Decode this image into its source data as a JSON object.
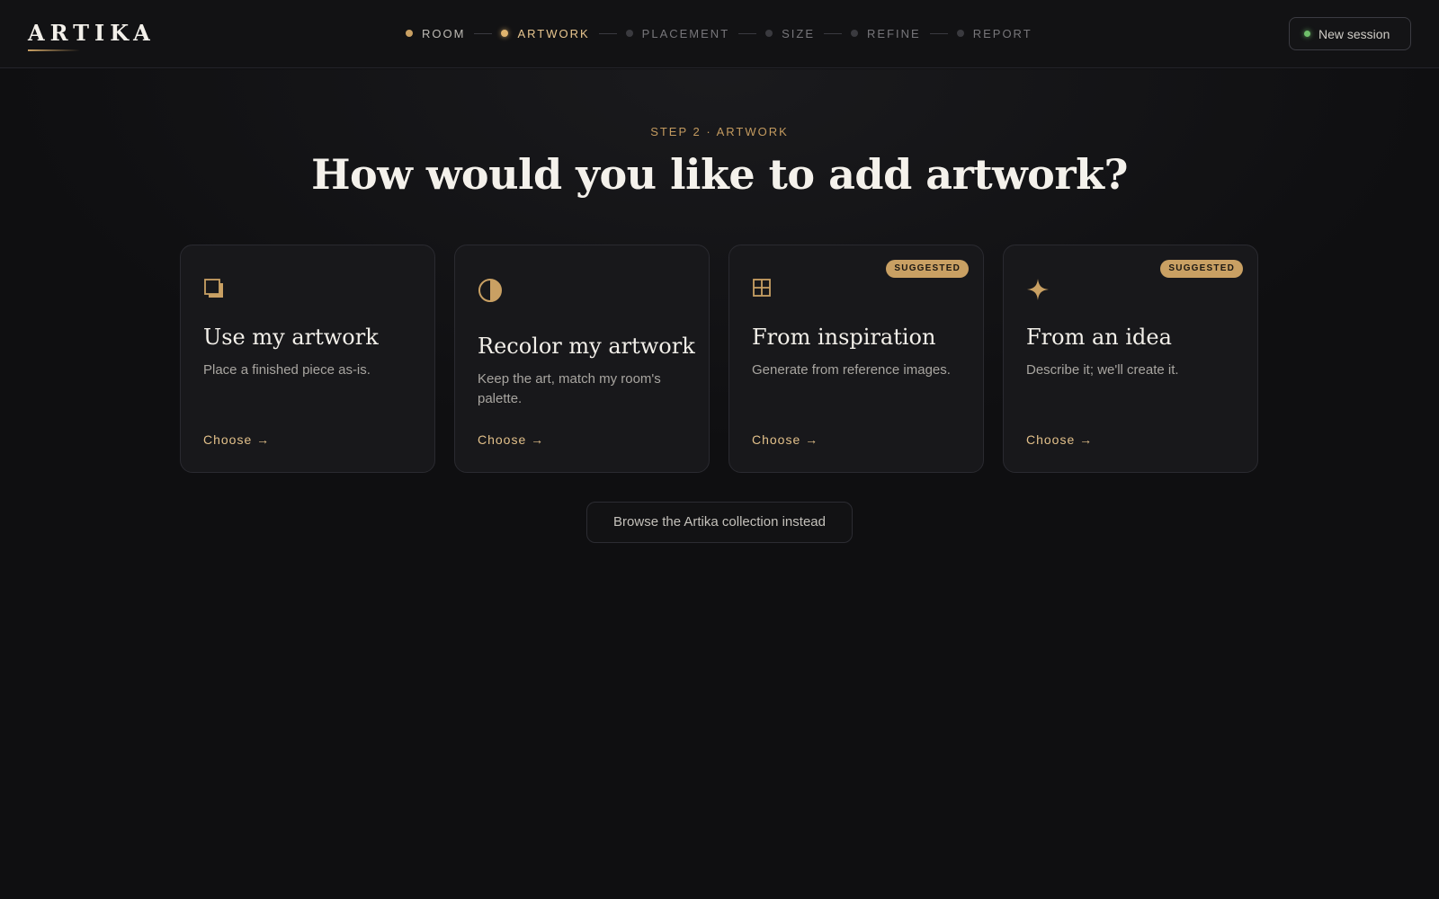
{
  "header": {
    "logo": "ARTIKA",
    "steps": [
      {
        "label": "ROOM",
        "state": "done"
      },
      {
        "label": "ARTWORK",
        "state": "active"
      },
      {
        "label": "PLACEMENT",
        "state": "pending"
      },
      {
        "label": "SIZE",
        "state": "pending"
      },
      {
        "label": "REFINE",
        "state": "pending"
      },
      {
        "label": "REPORT",
        "state": "pending"
      }
    ],
    "new_session": "New session"
  },
  "main": {
    "eyebrow": "STEP 2 · ARTWORK",
    "title": "How would you like to add artwork?",
    "cards": [
      {
        "icon": "stacked-squares-icon",
        "title": "Use my artwork",
        "desc": "Place a finished piece as-is.",
        "cta": "Choose →",
        "badge": ""
      },
      {
        "icon": "half-circle-icon",
        "title": "Recolor my artwork",
        "desc": "Keep the art, match my room's palette.",
        "cta": "Choose →",
        "badge": ""
      },
      {
        "icon": "grid-icon",
        "title": "From inspiration",
        "desc": "Generate from reference images.",
        "cta": "Choose →",
        "badge": "SUGGESTED"
      },
      {
        "icon": "sparkle-icon",
        "title": "From an idea",
        "desc": "Describe it; we'll create it.",
        "cta": "Choose →",
        "badge": "SUGGESTED"
      }
    ],
    "browse": "Browse the Artika collection instead"
  },
  "colors": {
    "accent": "#c9a063",
    "background": "#0f0f11",
    "card": "#18181b",
    "status": "#6fbf6a"
  }
}
